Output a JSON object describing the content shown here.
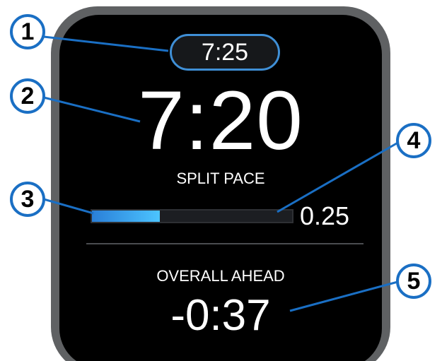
{
  "watch": {
    "time_of_day": "7:25",
    "split_pace_value": "7:20",
    "split_pace_label": "SPLIT PACE",
    "progress": {
      "value_text": "0.25",
      "fraction": 0.34
    },
    "overall_label": "OVERALL AHEAD",
    "overall_value": "-0:37"
  },
  "callouts": [
    "1",
    "2",
    "3",
    "4",
    "5"
  ],
  "colors": {
    "accent": "#3f8fd6",
    "progress_fill": "#4cc4ff",
    "callout_border": "#1a6fc4",
    "screen": "#000000",
    "bezel": "#5f6163"
  }
}
